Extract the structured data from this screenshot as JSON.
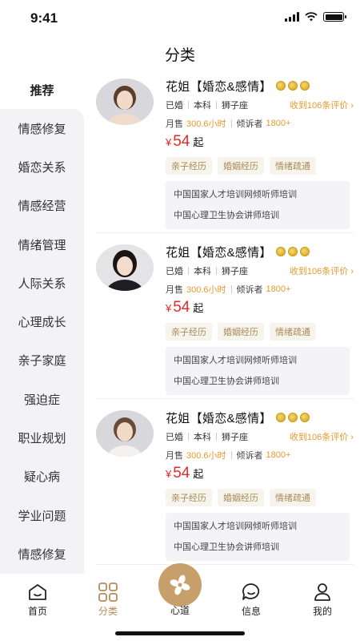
{
  "status": {
    "time": "9:41"
  },
  "header": {
    "title": "分类"
  },
  "sidebar": {
    "active": "推荐",
    "items": [
      "情感修复",
      "婚恋关系",
      "情感经营",
      "情绪管理",
      "人际关系",
      "心理成长",
      "亲子家庭",
      "强迫症",
      "职业规划",
      "疑心病",
      "学业问题",
      "情感修复"
    ]
  },
  "cards": [
    {
      "name": "花姐【婚恋&感情】",
      "marital": "已婚",
      "education": "本科",
      "zodiac": "狮子座",
      "reviews": "收到106条评价 ›",
      "sales_label": "月售",
      "sales_value": "300.6小时",
      "listeners_label": "倾诉者",
      "listeners_value": "1800+",
      "price_symbol": "¥",
      "price": "54",
      "price_suffix": "起",
      "tags": [
        "亲子经历",
        "婚姻经历",
        "情绪疏通"
      ],
      "certs": [
        "中国国家人才培训网倾听师培训",
        "中国心理卫生协会讲师培训"
      ]
    },
    {
      "name": "花姐【婚恋&感情】",
      "marital": "已婚",
      "education": "本科",
      "zodiac": "狮子座",
      "reviews": "收到106条评价 ›",
      "sales_label": "月售",
      "sales_value": "300.6小时",
      "listeners_label": "倾诉者",
      "listeners_value": "1800+",
      "price_symbol": "¥",
      "price": "54",
      "price_suffix": "起",
      "tags": [
        "亲子经历",
        "婚姻经历",
        "情绪疏通"
      ],
      "certs": [
        "中国国家人才培训网倾听师培训",
        "中国心理卫生协会讲师培训"
      ]
    },
    {
      "name": "花姐【婚恋&感情】",
      "marital": "已婚",
      "education": "本科",
      "zodiac": "狮子座",
      "reviews": "收到106条评价 ›",
      "sales_label": "月售",
      "sales_value": "300.6小时",
      "listeners_label": "倾诉者",
      "listeners_value": "1800+",
      "price_symbol": "¥",
      "price": "54",
      "price_suffix": "起",
      "tags": [
        "亲子经历",
        "婚姻经历",
        "情绪疏通"
      ],
      "certs": [
        "中国国家人才培训网倾听师培训",
        "中国心理卫生协会讲师培训"
      ]
    }
  ],
  "tabbar": {
    "home": "首页",
    "category": "分类",
    "center": "心道",
    "messages": "信息",
    "mine": "我的"
  },
  "colors": {
    "accent": "#c79f6b",
    "price": "#e02a2a",
    "highlight": "#e89a2c"
  },
  "icons": [
    "home-icon",
    "category-icon",
    "center-logo-icon",
    "message-icon",
    "profile-icon",
    "medal-icon"
  ]
}
